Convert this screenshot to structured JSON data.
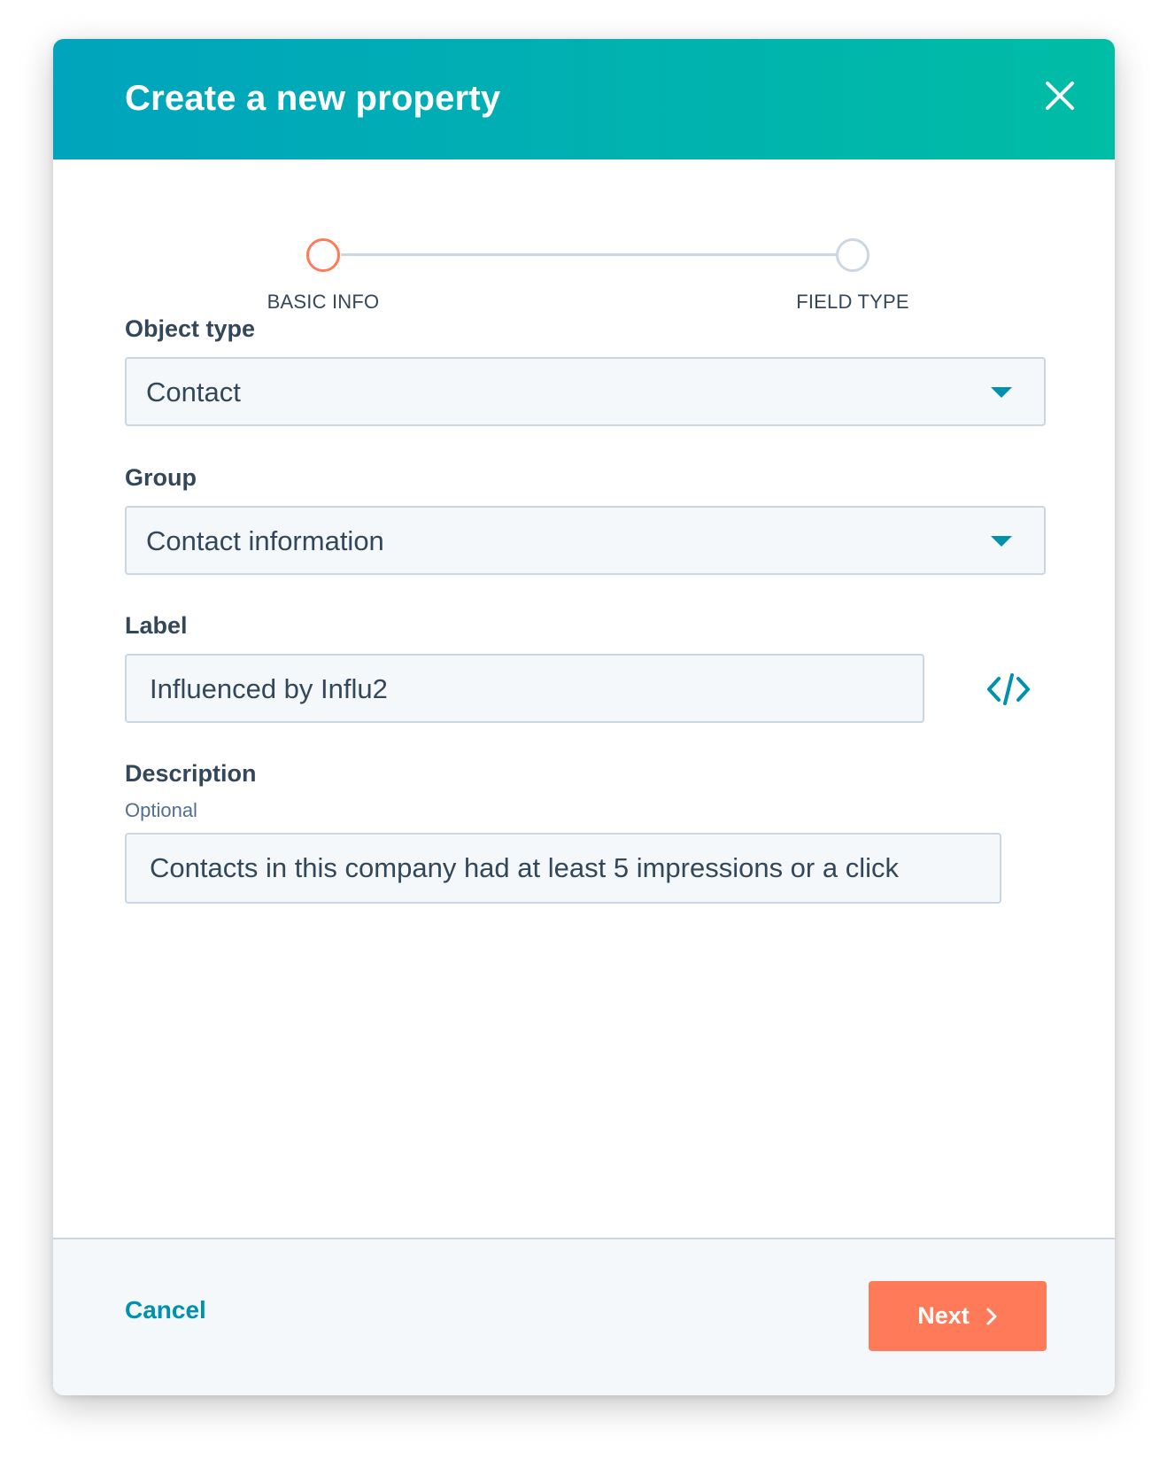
{
  "modal": {
    "title": "Create a new property",
    "close_icon": "close-icon"
  },
  "stepper": {
    "steps": [
      {
        "label": "BASIC INFO",
        "state": "active"
      },
      {
        "label": "FIELD TYPE",
        "state": "inactive"
      }
    ]
  },
  "form": {
    "object_type": {
      "label": "Object type",
      "value": "Contact"
    },
    "group": {
      "label": "Group",
      "value": "Contact information"
    },
    "label": {
      "label": "Label",
      "value": "Influenced by Influ2",
      "icon": "code-icon"
    },
    "description": {
      "label": "Description",
      "sublabel": "Optional",
      "value": "Contacts in this company had at least 5 impressions or a click"
    }
  },
  "footer": {
    "cancel_label": "Cancel",
    "next_label": "Next",
    "next_icon": "chevron-right-icon"
  },
  "colors": {
    "header_gradient_start": "#00a4bd",
    "header_gradient_end": "#00bda5",
    "accent_orange": "#ff7a59",
    "link_teal": "#0091ae",
    "text_dark": "#33475b",
    "border": "#cbd6e2"
  }
}
